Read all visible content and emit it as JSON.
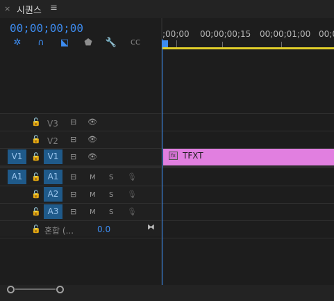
{
  "panel": {
    "close_glyph": "×",
    "title": "시퀀스",
    "menu_glyph": "≡"
  },
  "timecode": "00;00;00;00",
  "toolbar": [
    {
      "name": "snap-icon",
      "glyph": "✲"
    },
    {
      "name": "linked-selection-icon",
      "glyph": "∩"
    },
    {
      "name": "insert-overwrite-icon",
      "glyph": "⬕"
    },
    {
      "name": "marker-icon",
      "glyph": "⬟"
    },
    {
      "name": "wrench-icon",
      "glyph": "🔧"
    },
    {
      "name": "captions-icon",
      "glyph": "CC"
    }
  ],
  "ruler": {
    "labels": [
      ";00;00",
      "00;00;00;15",
      "00;00;01;00",
      "00;0"
    ]
  },
  "tracks": {
    "video": [
      {
        "source": "",
        "lock": "🔓",
        "name": "V3",
        "targeted": false,
        "eye": "👁"
      },
      {
        "source": "",
        "lock": "🔓",
        "name": "V2",
        "targeted": false,
        "eye": "👁"
      },
      {
        "source": "V1",
        "lock": "🔓",
        "name": "V1",
        "targeted": true,
        "eye": "👁"
      }
    ],
    "audio": [
      {
        "source": "A1",
        "lock": "🔓",
        "name": "A1",
        "m": "M",
        "s": "S"
      },
      {
        "source": "",
        "lock": "🔓",
        "name": "A2",
        "m": "M",
        "s": "S"
      },
      {
        "source": "",
        "lock": "🔓",
        "name": "A3",
        "m": "M",
        "s": "S"
      }
    ],
    "mix": {
      "lock": "🔓",
      "label": "혼합 (...",
      "value": "0.0"
    }
  },
  "clip": {
    "fx": "fx",
    "name": "TFXT",
    "color": "#e17fe0"
  },
  "colors": {
    "accent": "#3d8cf0",
    "track_target": "#1f5a8a",
    "ruler_bar": "#e2cf2a"
  }
}
